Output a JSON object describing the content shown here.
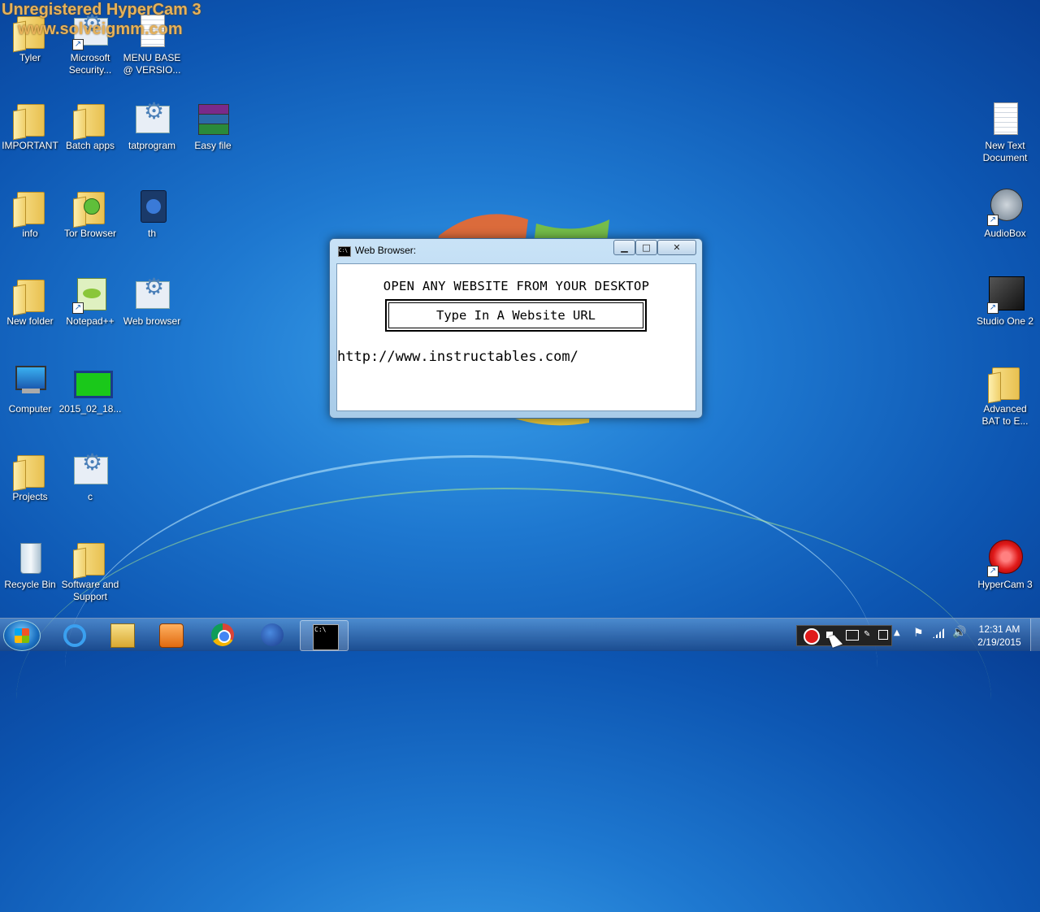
{
  "watermark": {
    "line1": "Unregistered HyperCam 3",
    "line2": "www.solveigmm.com"
  },
  "desktop": {
    "icons": [
      {
        "label": "Tyler",
        "icon": "user-folder-icon"
      },
      {
        "label": "Microsoft Security...",
        "icon": "microsoft-security-icon"
      },
      {
        "label": "MENU BASE @ VERSIO...",
        "icon": "document-icon"
      },
      {
        "label": "IMPORTANT",
        "icon": "folder-icon"
      },
      {
        "label": "Batch apps",
        "icon": "folder-icon"
      },
      {
        "label": "tatprogram",
        "icon": "batch-file-icon"
      },
      {
        "label": "Easy file",
        "icon": "winrar-archive-icon"
      },
      {
        "label": "info",
        "icon": "folder-icon"
      },
      {
        "label": "Tor Browser",
        "icon": "tor-folder-icon"
      },
      {
        "label": "th",
        "icon": "firefox-file-icon"
      },
      {
        "label": "New folder",
        "icon": "folder-icon"
      },
      {
        "label": "Notepad++",
        "icon": "notepad-plus-plus-icon"
      },
      {
        "label": "Web browser",
        "icon": "batch-file-icon"
      },
      {
        "label": "Computer",
        "icon": "computer-icon"
      },
      {
        "label": "2015_02_18...",
        "icon": "video-file-icon"
      },
      {
        "label": "Projects",
        "icon": "folder-icon"
      },
      {
        "label": "c",
        "icon": "batch-file-icon"
      },
      {
        "label": "Recycle Bin",
        "icon": "recycle-bin-icon"
      },
      {
        "label": "Software and Support",
        "icon": "folder-icon"
      },
      {
        "label": "New Text Document",
        "icon": "text-document-icon"
      },
      {
        "label": "AudioBox",
        "icon": "usb-device-icon"
      },
      {
        "label": "Studio One 2",
        "icon": "studio-one-icon"
      },
      {
        "label": "Advanced BAT to E...",
        "icon": "folder-icon"
      },
      {
        "label": "HyperCam 3",
        "icon": "hypercam-icon"
      }
    ]
  },
  "window": {
    "title": "Web Browser:",
    "heading": "OPEN ANY WEBSITE FROM YOUR DESKTOP",
    "box_label": "Type In A Website URL",
    "url": "http://www.instructables.com/",
    "controls": {
      "minimize": "minimize-icon",
      "maximize": "maximize-icon",
      "close": "close-icon"
    }
  },
  "taskbar": {
    "pinned": [
      {
        "name": "internet-explorer",
        "icon": "internet-explorer-icon"
      },
      {
        "name": "windows-explorer",
        "icon": "folder-library-icon"
      },
      {
        "name": "media-player",
        "icon": "media-player-icon"
      },
      {
        "name": "chrome",
        "icon": "chrome-icon"
      },
      {
        "name": "firefox",
        "icon": "firefox-icon"
      },
      {
        "name": "command-prompt",
        "icon": "command-prompt-icon",
        "active": true
      }
    ],
    "clock": {
      "time": "12:31 AM",
      "date": "2/19/2015"
    }
  },
  "colors": {
    "desktop": "#1e78d0",
    "watermark": "#e6b15a",
    "taskbar": "#2a5a9a"
  }
}
